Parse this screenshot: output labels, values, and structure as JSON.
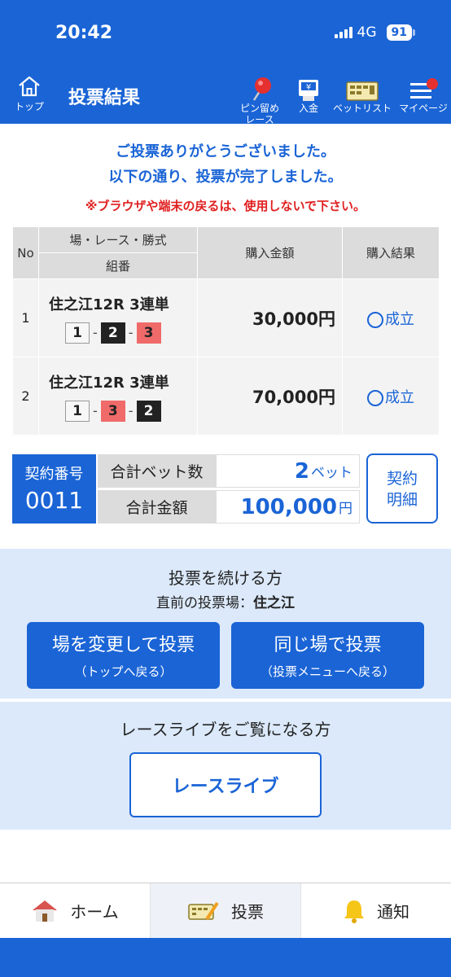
{
  "status": {
    "time": "20:42",
    "network": "4G",
    "battery": "91"
  },
  "header": {
    "home_label": "トップ",
    "title": "投票結果",
    "pin_label_1": "ピン留め",
    "pin_label_2": "レース",
    "deposit_label": "入金",
    "betlist_label": "ベットリスト",
    "mypage_label": "マイページ"
  },
  "messages": {
    "line1": "ご投票ありがとうございました。",
    "line2": "以下の通り、投票が完了しました。",
    "warning": "※ブラウザや端末の戻るは、使用しないで下さい。"
  },
  "table": {
    "headers": {
      "no": "No",
      "race": "場・レース・勝式",
      "combo": "組番",
      "amount": "購入金額",
      "result": "購入結果"
    },
    "rows": [
      {
        "no": "1",
        "race": "住之江12R 3連単",
        "combo": [
          "1",
          "2",
          "3"
        ],
        "dash": "-",
        "amount": "30,000円",
        "result": "成立"
      },
      {
        "no": "2",
        "race": "住之江12R 3連単",
        "combo": [
          "1",
          "3",
          "2"
        ],
        "dash": "-",
        "amount": "70,000円",
        "result": "成立"
      }
    ]
  },
  "summary": {
    "contract_label": "契約番号",
    "contract_no": "0011",
    "bets_label": "合計ベット数",
    "bets_value": "2",
    "bets_unit": "ベット",
    "total_label": "合計金額",
    "total_value": "100,000",
    "total_unit": "円",
    "detail_line1": "契約",
    "detail_line2": "明細"
  },
  "continue": {
    "title": "投票を続ける方",
    "sub_prefix": "直前の投票場：",
    "sub_venue": "住之江",
    "btn1_main": "場を変更して投票",
    "btn1_sub": "（トップへ戻る）",
    "btn2_main": "同じ場で投票",
    "btn2_sub": "（投票メニューへ戻る）"
  },
  "live": {
    "title": "レースライブをご覧になる方",
    "button": "レースライブ"
  },
  "tabs": {
    "home": "ホーム",
    "vote": "投票",
    "notify": "通知"
  },
  "colors": {
    "primary": "#1a64d6",
    "warning": "#e02020",
    "panel": "#dbe9fa",
    "red_box": "#f06a6a",
    "black_box": "#222222"
  }
}
